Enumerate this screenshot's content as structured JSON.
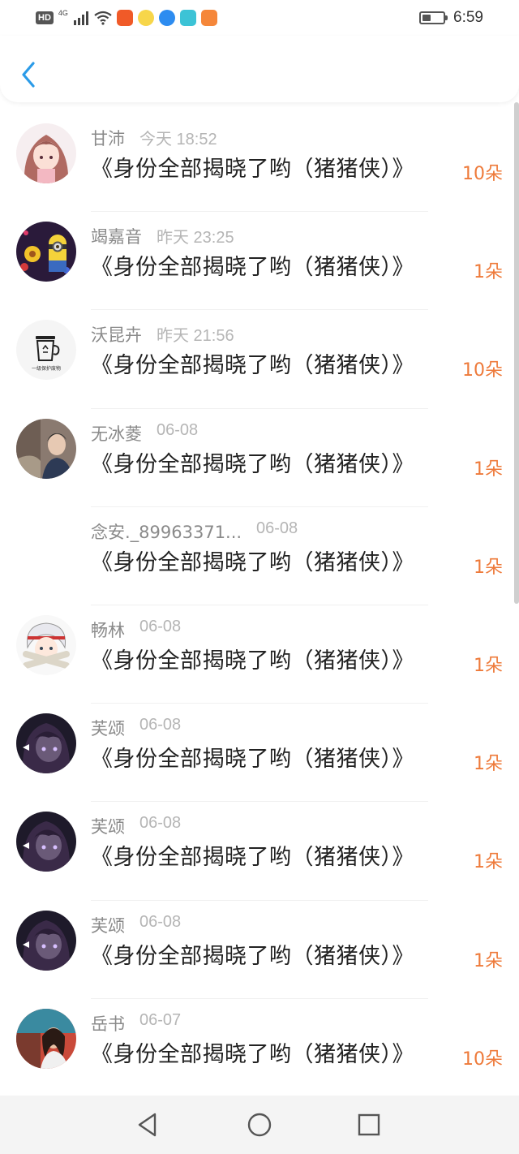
{
  "status_bar": {
    "hd_label": "HD",
    "network_label": "4G",
    "time": "6:59",
    "battery_level": 0.35
  },
  "header": {
    "back_icon": "chevron-left-icon",
    "accent_color": "#2b9be8"
  },
  "gifts": {
    "count_color": "#ee7a3a",
    "items": [
      {
        "name": "甘沛",
        "time": "今天 18:52",
        "title": "《身份全部揭晓了哟（猪猪侠）》",
        "count": "10朵",
        "avatar": "anime-girl-pink"
      },
      {
        "name": "竭嘉音",
        "time": "昨天 23:25",
        "title": "《身份全部揭晓了哟（猪猪侠）》",
        "count": "1朵",
        "avatar": "minion-flowers"
      },
      {
        "name": "沃昆卉",
        "time": "昨天 21:56",
        "title": "《身份全部揭晓了哟（猪猪侠）》",
        "count": "10朵",
        "avatar": "trash-can-cartoon",
        "avatar_caption": "一级保护废物"
      },
      {
        "name": "无冰菱",
        "time": "06-08",
        "title": "《身份全部揭晓了哟（猪猪侠）》",
        "count": "1朵",
        "avatar": "boy-photo"
      },
      {
        "name": "念安._89963371...",
        "time": "06-08",
        "title": "《身份全部揭晓了哟（猪猪侠）》",
        "count": "1朵",
        "avatar": ""
      },
      {
        "name": "畅林",
        "time": "06-08",
        "title": "《身份全部揭晓了哟（猪猪侠）》",
        "count": "1朵",
        "avatar": "anime-boy-white"
      },
      {
        "name": "芙颂",
        "time": "06-08",
        "title": "《身份全部揭晓了哟（猪猪侠）》",
        "count": "1朵",
        "avatar": "anime-dark"
      },
      {
        "name": "芙颂",
        "time": "06-08",
        "title": "《身份全部揭晓了哟（猪猪侠）》",
        "count": "1朵",
        "avatar": "anime-dark"
      },
      {
        "name": "芙颂",
        "time": "06-08",
        "title": "《身份全部揭晓了哟（猪猪侠）》",
        "count": "1朵",
        "avatar": "anime-dark"
      },
      {
        "name": "岳书",
        "time": "06-07",
        "title": "《身份全部揭晓了哟（猪猪侠）》",
        "count": "10朵",
        "avatar": "girl-red-photo"
      }
    ]
  },
  "nav_bar": {
    "buttons": [
      "back-triangle-icon",
      "home-circle-icon",
      "recents-square-icon"
    ]
  }
}
